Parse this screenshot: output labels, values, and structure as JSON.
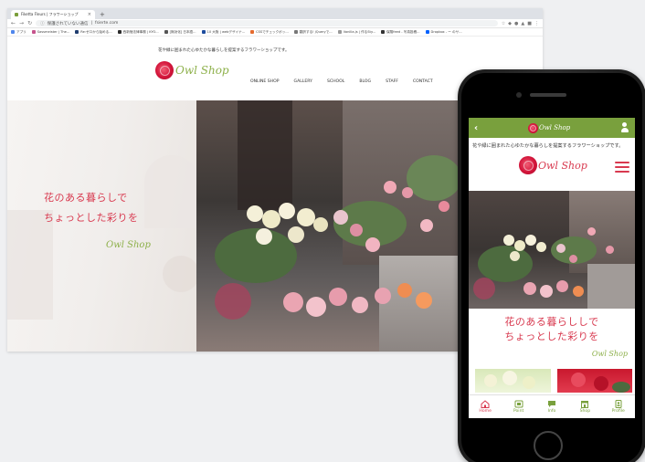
{
  "browser": {
    "tab_title": "Fiketta Fleurs | フラワーショップ",
    "url_warning": "保護されていない通信",
    "url": "fsierte.com",
    "bookmarks": [
      "アプリ",
      "Sassmeister | The...",
      "Re:ゼロから始める...",
      "西新宿法律事務 | KYO...",
      "[無効化] 日本語...",
      "10 大阪 | webデザイナ...",
      "CSSでチェックボッ...",
      "翻訳する! jQueryで...",
      "Vanilla.js | 作るSty...",
      "保険feed - 写真投稿...",
      "Dropbox - ー のサ..."
    ]
  },
  "site": {
    "tagline": "花や緑に囲まれた心ゆたかな暮らしを提案するフラワーショップです。",
    "logo_text": "Owl Shop",
    "nav": [
      "ONLINE SHOP",
      "GALLERY",
      "SCHOOL",
      "BLOG",
      "STAFF",
      "CONTACT"
    ],
    "hero_line1": "花のある暮らしで",
    "hero_line2": "ちょっとした彩りを",
    "hero_signature": "Owl Shop"
  },
  "mobile": {
    "back_icon": "chevron-left-icon",
    "top_logo_text": "Owl Shop",
    "tagline": "花や緑に囲まれた心ゆたかな暮らしを提案するフラワーショップです。",
    "logo_text": "Owl Shop",
    "hero_line1": "花のある暮らししで",
    "hero_line2": "ちょっとした彩りを",
    "signature": "Owl Shop",
    "tabs": [
      {
        "label": "Home",
        "icon": "home-icon"
      },
      {
        "label": "Point",
        "icon": "point-card-icon"
      },
      {
        "label": "Info",
        "icon": "info-bubble-icon"
      },
      {
        "label": "Shop",
        "icon": "shop-icon"
      },
      {
        "label": "Profile",
        "icon": "profile-icon"
      }
    ]
  },
  "colors": {
    "brand_green": "#79a03d",
    "brand_red": "#d8394f",
    "logo_green": "#8db04a"
  }
}
